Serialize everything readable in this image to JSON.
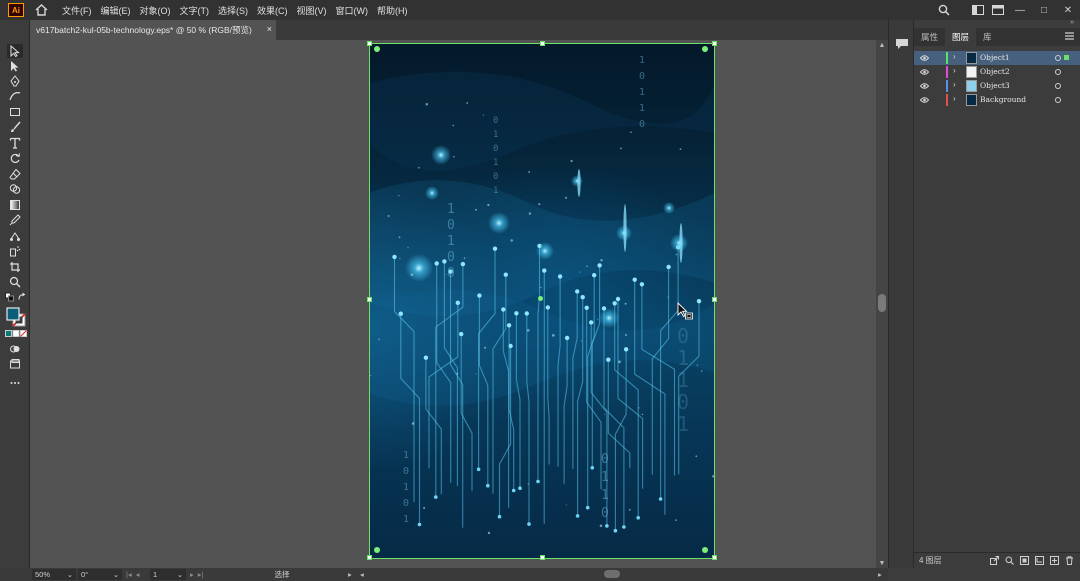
{
  "app": {
    "logo_text": "Ai",
    "menu": [
      "文件(F)",
      "编辑(E)",
      "对象(O)",
      "文字(T)",
      "选择(S)",
      "效果(C)",
      "视图(V)",
      "窗口(W)",
      "帮助(H)"
    ]
  },
  "window_controls": {
    "minimize": "—",
    "maximize": "□",
    "close": "✕"
  },
  "document": {
    "tab_title": "v617batch2-kul-05b-technology.eps* @ 50 % (RGB/预览)",
    "tab_close": "×"
  },
  "panel": {
    "tabs": [
      "属性",
      "图层",
      "库"
    ],
    "active_tab": "图层",
    "collapse": "»",
    "menu_icon": "hamburger-icon",
    "layers": [
      {
        "name": "Object1",
        "color": "#59e36b",
        "thumb": "dark-blue",
        "selected": true
      },
      {
        "name": "Object2",
        "color": "#d94fd9",
        "thumb": "white",
        "selected": false
      },
      {
        "name": "Object3",
        "color": "#5b8ee8",
        "thumb": "light-blue",
        "selected": false
      },
      {
        "name": "Background",
        "color": "#e05050",
        "thumb": "dark-blue",
        "selected": false
      }
    ],
    "footer_label": "4 图层"
  },
  "status": {
    "zoom": "50%",
    "rotation": "0°",
    "artboard": "1",
    "tool": "选择"
  },
  "artwork": {
    "binary_columns": [
      {
        "digits": "10100"
      },
      {
        "digits": "010101"
      },
      {
        "digits": "10110"
      },
      {
        "digits": "0110"
      },
      {
        "digits": "10101"
      },
      {
        "digits": "01101"
      }
    ]
  },
  "colors": {
    "selection": "#6be36b",
    "accent": "#46607d",
    "glow": "#4fd2ff"
  }
}
